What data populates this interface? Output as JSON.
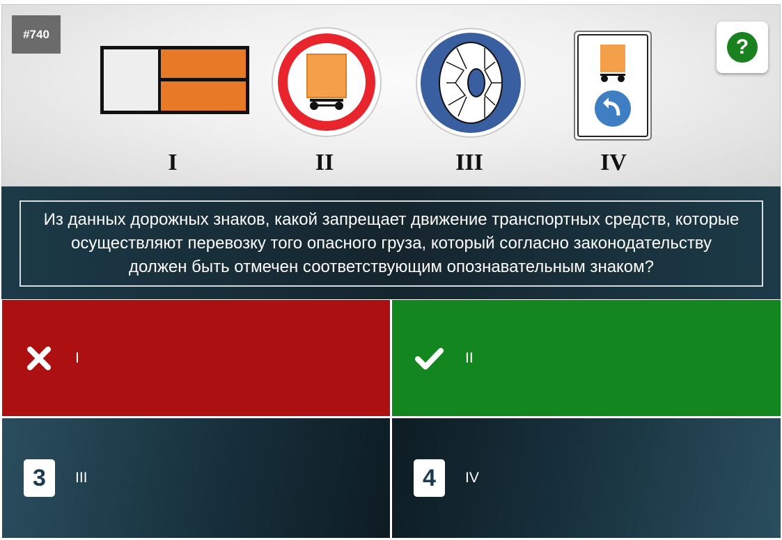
{
  "question_number": "#740",
  "help_button": {
    "label": "?"
  },
  "signs": [
    {
      "roman": "I",
      "icon": "orange-plate-sign-icon"
    },
    {
      "roman": "II",
      "icon": "no-dangerous-goods-vehicle-sign-icon"
    },
    {
      "roman": "III",
      "icon": "snow-chains-mandatory-sign-icon"
    },
    {
      "roman": "IV",
      "icon": "dangerous-goods-direction-sign-icon"
    }
  ],
  "question_text": "Из данных дорожных знаков, какой запрещает движение транспортных средств, которые осуществляют перевозку того опасного груза, который согласно законодательству должен быть отмечен соответствующим опознавательным знаком?",
  "answers": [
    {
      "label": "I",
      "state": "wrong",
      "icon": "cross-icon"
    },
    {
      "label": "II",
      "state": "correct",
      "icon": "check-icon"
    },
    {
      "number": "3",
      "label": "III",
      "state": "neutral"
    },
    {
      "number": "4",
      "label": "IV",
      "state": "neutral"
    }
  ],
  "colors": {
    "wrong": "#ad1010",
    "correct": "#148620",
    "neutral": "#17303c"
  }
}
